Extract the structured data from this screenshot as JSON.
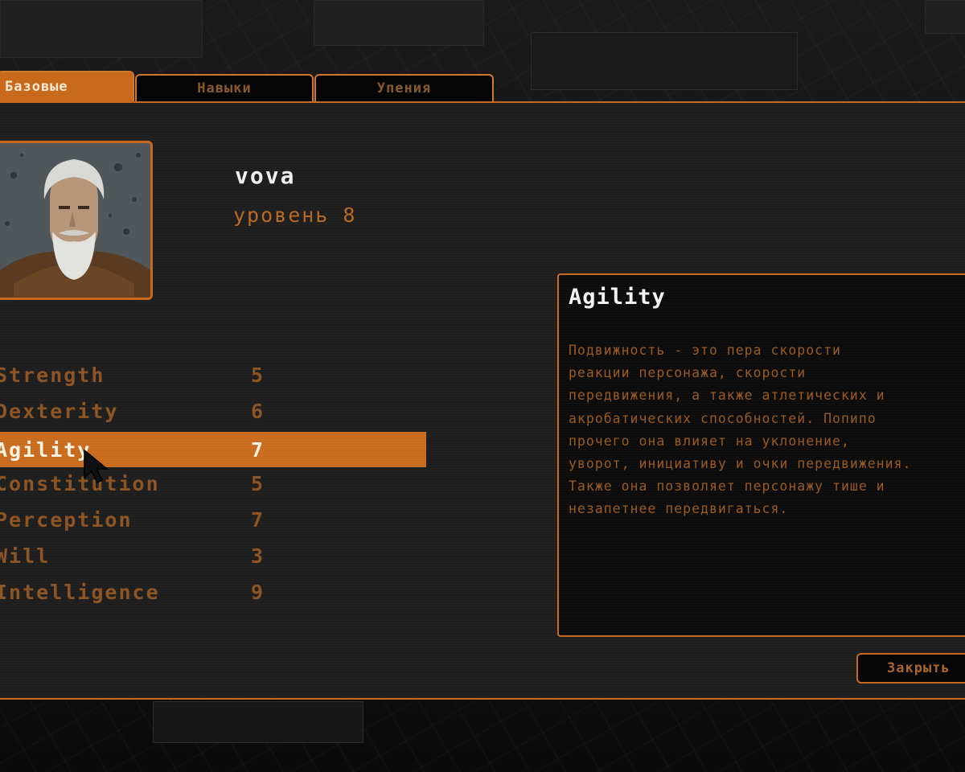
{
  "tabs": [
    {
      "label": "Базовые",
      "active": true
    },
    {
      "label": "Навыки",
      "active": false
    },
    {
      "label": "Упения",
      "active": false
    }
  ],
  "character": {
    "name": "vova",
    "level_text": "уровень 8"
  },
  "stats": [
    {
      "name": "Strength",
      "value": "5",
      "selected": false
    },
    {
      "name": "Dexterity",
      "value": "6",
      "selected": false
    },
    {
      "name": "Agility",
      "value": "7",
      "selected": true
    },
    {
      "name": "Constitution",
      "value": "5",
      "selected": false
    },
    {
      "name": "Perception",
      "value": "7",
      "selected": false
    },
    {
      "name": "Will",
      "value": "3",
      "selected": false
    },
    {
      "name": "Intelligence",
      "value": "9",
      "selected": false
    }
  ],
  "description": {
    "title": "Agility",
    "text": "Подвижность - это пера скорости\nреакции персонажа, скорости\nпередвижения, а также атлетических и\nакробатических способностей. Попипо\nпрочего она влияет на уклонение,\nуворот, инициативу и очки передвижения.\nТакже она позволяет персонажу тише и\nнезапетнее передвигаться."
  },
  "buttons": {
    "close_label": "Закрыть"
  },
  "colors": {
    "accent": "#c8691c",
    "text_dim": "#8e5524",
    "panel_bg": "#1e1e1e"
  }
}
